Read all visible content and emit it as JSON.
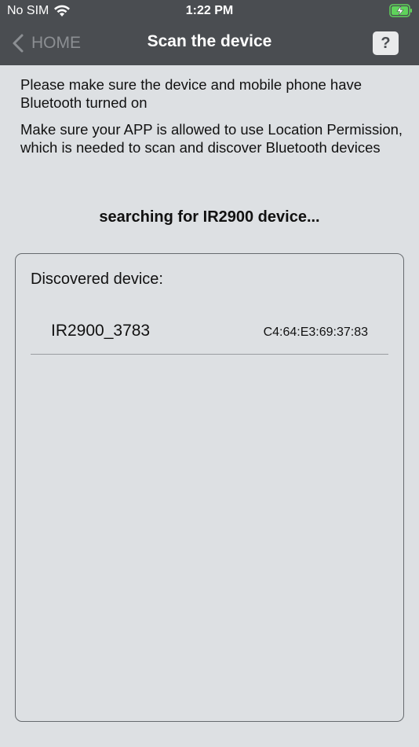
{
  "status_bar": {
    "carrier": "No SIM",
    "time": "1:22 PM"
  },
  "nav": {
    "back_label": "HOME",
    "title": "Scan the device",
    "help_label": "?"
  },
  "instructions": [
    "Please make sure the device and mobile phone have Bluetooth turned on",
    "Make sure your APP is allowed to use Location Permission, which is needed to scan and discover Bluetooth devices"
  ],
  "status_message": "searching for IR2900 device...",
  "device_panel": {
    "heading": "Discovered device:",
    "devices": [
      {
        "name": "IR2900_3783",
        "mac": "C4:64:E3:69:37:83"
      }
    ]
  },
  "colors": {
    "header_bg": "#4a4d51",
    "page_bg": "#dde0e3",
    "battery_green": "#5fd35b"
  }
}
